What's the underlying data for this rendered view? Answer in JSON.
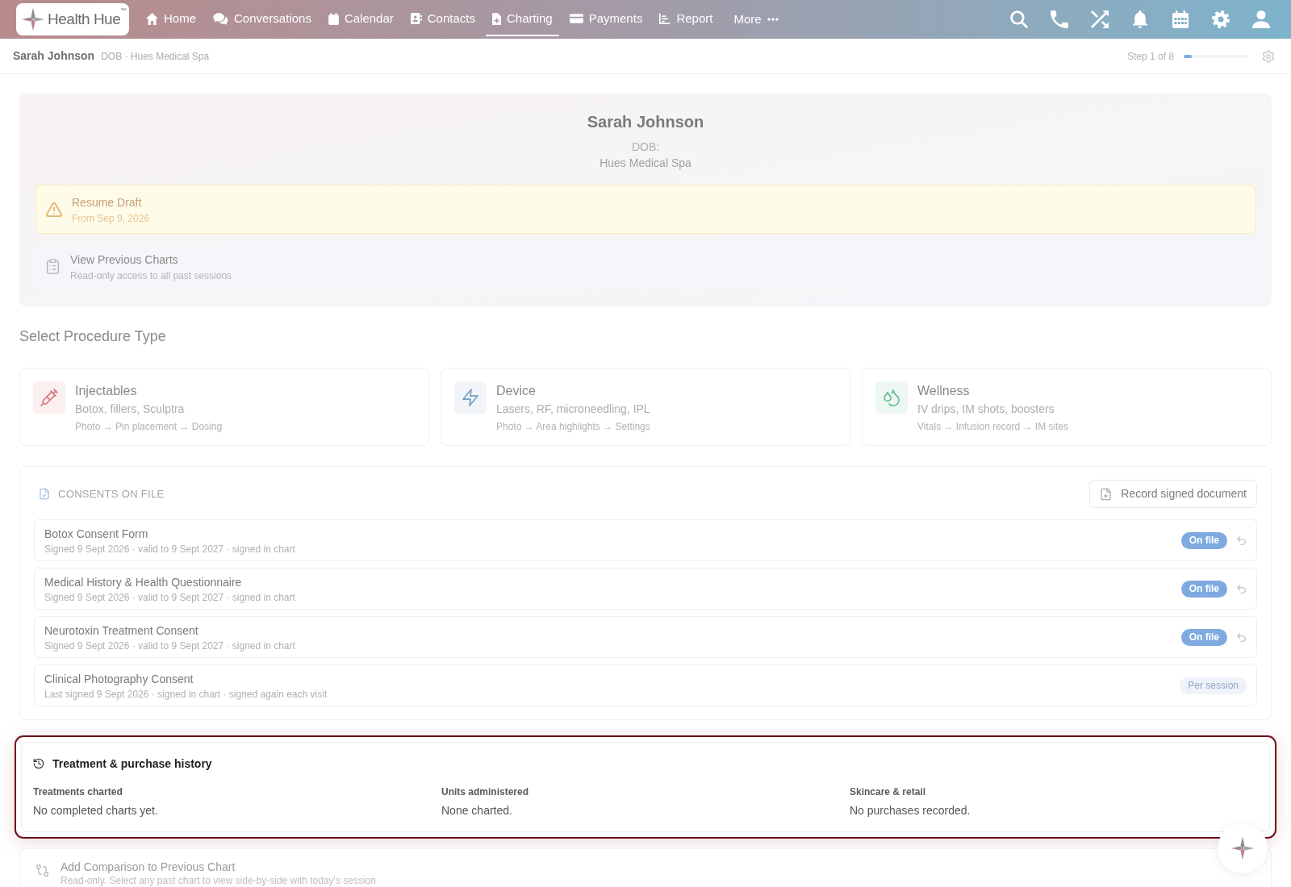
{
  "nav": {
    "logo": "Health Hue$^{™}$",
    "items": [
      {
        "label": "Home",
        "selected": false
      },
      {
        "label": "Conversations",
        "selected": false
      },
      {
        "label": "Calendar",
        "selected": false
      },
      {
        "label": "Contacts",
        "selected": false
      },
      {
        "label": "Charting",
        "selected": true
      },
      {
        "label": "Payments",
        "selected": false
      },
      {
        "label": "Report",
        "selected": false
      }
    ],
    "more": "More"
  },
  "patient_bar": {
    "name": "Sarah Johnson",
    "details": "DOB · Hues Medical Spa",
    "step": "Step 1 of 8",
    "level": 0.125
  },
  "patient_card": {
    "name": "Sarah Johnson",
    "dob": "DOB:",
    "clinic": "Hues Medical Spa",
    "draft": {
      "title": "Resume Draft",
      "subtitle": "From Sep 9, 2026"
    },
    "previous_charts": {
      "title": "View Previous Charts",
      "subtitle": "Read-only access to all past sessions"
    }
  },
  "procedures": {
    "heading": "Select Procedure Type",
    "types": [
      {
        "title": "Injectables",
        "description": "Botox, fillers, Sculptra",
        "steps": "Photo → Pin placement → Dosing"
      },
      {
        "title": "Device",
        "description": "Lasers, RF, microneedling, IPL",
        "steps": "Photo → Area highlights → Settings"
      },
      {
        "title": "Wellness",
        "description": "IV drips, IM shots, boosters",
        "steps": "Vitals → Infusion record → IM sites"
      }
    ]
  },
  "consents": {
    "title": "CONSENTS ON FILE",
    "action": "Record signed document",
    "items": [
      {
        "name": "Botox Consent Form",
        "detail": "Signed 9 Sept 2026 · valid to 9 Sept 2027 · signed in chart",
        "status": "On file",
        "kind": "on_file"
      },
      {
        "name": "Medical History & Health Questionnaire",
        "detail": "Signed 9 Sept 2026 · valid to 9 Sept 2027 · signed in chart",
        "status": "On file",
        "kind": "on_file"
      },
      {
        "name": "Neurotoxin Treatment Consent",
        "detail": "Signed 9 Sept 2026 · valid to 9 Sept 2027 · signed in chart",
        "status": "On file",
        "kind": "on_file"
      },
      {
        "name": "Clinical Photography Consent",
        "detail": "Last signed 9 Sept 2026 · signed in chart · signed again each visit",
        "status": "Per session",
        "kind": "per_session"
      }
    ]
  },
  "history": {
    "title": "Treatment & purchase history",
    "highlighted": true,
    "columns": [
      {
        "label": "Treatments charted",
        "value": "No completed charts yet."
      },
      {
        "label": "Units administered",
        "value": "None charted."
      },
      {
        "label": "Skincare & retail",
        "value": "No purchases recorded."
      }
    ]
  },
  "comparison": {
    "title": "Add Comparison to Previous Chart",
    "subtitle": "Read-only. Select any past chart to view side-by-side with today's session"
  }
}
